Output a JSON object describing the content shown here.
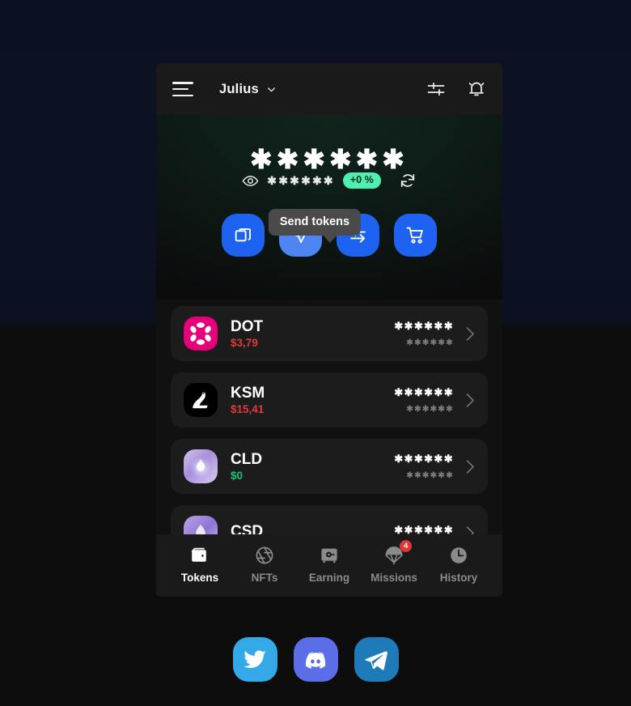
{
  "header": {
    "menu_icon": "hamburger-menu-icon",
    "account_name": "Julius",
    "chevron_icon": "chevron-down-icon",
    "settings_icon": "sliders-settings-icon",
    "notifications_icon": "bell-icon"
  },
  "hero": {
    "balance_masked": "✱✱✱✱✱✱",
    "eye_icon": "eye-hide-balance-icon",
    "sub_amount_masked": "✱✱✱✱✱✱",
    "change_percent": "+0 %",
    "change_color": "#4df0b0",
    "refresh_icon": "refresh-icon",
    "tooltip": "Send tokens",
    "actions": [
      {
        "name": "receive",
        "icon": "copy-squares-icon",
        "highlighted": false
      },
      {
        "name": "send",
        "icon": "paper-plane-icon",
        "highlighted": true
      },
      {
        "name": "swap",
        "icon": "swap-arrows-icon",
        "highlighted": false
      },
      {
        "name": "buy",
        "icon": "shopping-cart-icon",
        "highlighted": false
      }
    ]
  },
  "tokens": [
    {
      "symbol": "DOT",
      "price": "$3,79",
      "price_color": "#e03b3b",
      "balance_masked": "✱✱✱✱✱✱",
      "fiat_masked": "✱✱✱✱✱✱",
      "icon": "polkadot-icon",
      "icon_color": "#e6007a"
    },
    {
      "symbol": "KSM",
      "price": "$15,41",
      "price_color": "#e03b3b",
      "balance_masked": "✱✱✱✱✱✱",
      "fiat_masked": "✱✱✱✱✱✱",
      "icon": "kusama-bird-icon",
      "icon_color": "#000000"
    },
    {
      "symbol": "CLD",
      "price": "$0",
      "price_color": "#19c37d",
      "balance_masked": "✱✱✱✱✱✱",
      "fiat_masked": "✱✱✱✱✱✱",
      "icon": "cloud-droplet-icon",
      "icon_color": "#b9a8e0"
    },
    {
      "symbol": "CSD",
      "price": "",
      "price_color": "#e03b3b",
      "balance_masked": "✱✱✱✱✱✱",
      "fiat_masked": "",
      "icon": "csd-droplet-icon",
      "icon_color": "#9b86d8"
    }
  ],
  "bottom_nav": [
    {
      "label": "Tokens",
      "icon": "wallet-icon",
      "active": true,
      "badge": ""
    },
    {
      "label": "NFTs",
      "icon": "aperture-icon",
      "active": false,
      "badge": ""
    },
    {
      "label": "Earning",
      "icon": "safe-vault-icon",
      "active": false,
      "badge": ""
    },
    {
      "label": "Missions",
      "icon": "parachute-icon",
      "active": false,
      "badge": "4"
    },
    {
      "label": "History",
      "icon": "clock-icon",
      "active": false,
      "badge": ""
    }
  ],
  "socials": [
    {
      "name": "twitter",
      "icon": "twitter-bird-icon",
      "color": "#34a9e8"
    },
    {
      "name": "discord",
      "icon": "discord-icon",
      "color": "#5b6ee8"
    },
    {
      "name": "telegram",
      "icon": "telegram-plane-icon",
      "color": "#1e7bb8"
    }
  ]
}
